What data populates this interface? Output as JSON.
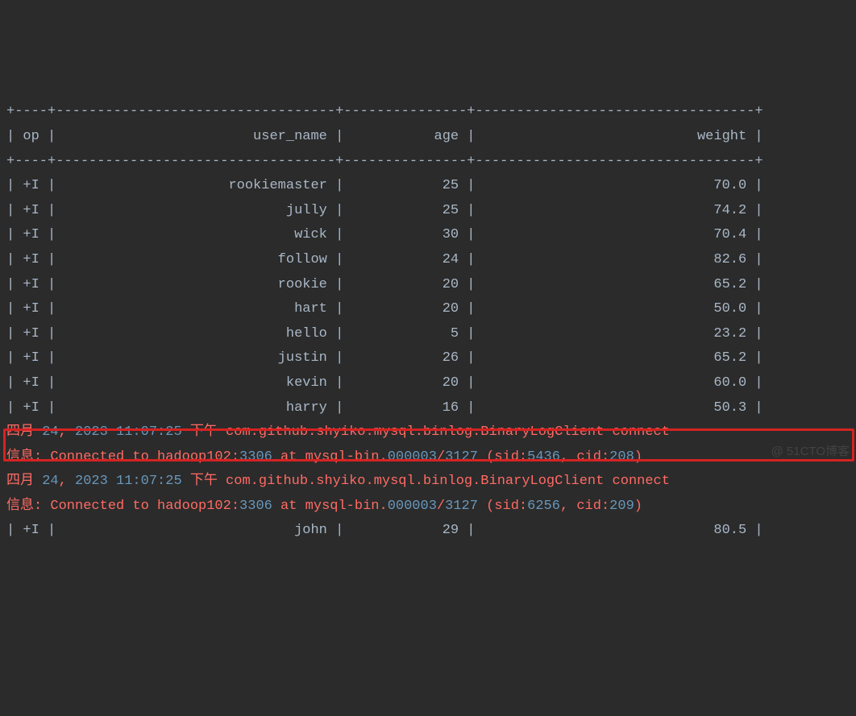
{
  "chart_data": {
    "type": "table",
    "columns": [
      "op",
      "user_name",
      "age",
      "weight"
    ],
    "rows": [
      {
        "op": "+I",
        "user_name": "rookiemaster",
        "age": 25,
        "weight": 70.0
      },
      {
        "op": "+I",
        "user_name": "jully",
        "age": 25,
        "weight": 74.2
      },
      {
        "op": "+I",
        "user_name": "wick",
        "age": 30,
        "weight": 70.4
      },
      {
        "op": "+I",
        "user_name": "follow",
        "age": 24,
        "weight": 82.6
      },
      {
        "op": "+I",
        "user_name": "rookie",
        "age": 20,
        "weight": 65.2
      },
      {
        "op": "+I",
        "user_name": "hart",
        "age": 20,
        "weight": 50.0
      },
      {
        "op": "+I",
        "user_name": "hello",
        "age": 5,
        "weight": 23.2
      },
      {
        "op": "+I",
        "user_name": "justin",
        "age": 26,
        "weight": 65.2
      },
      {
        "op": "+I",
        "user_name": "kevin",
        "age": 20,
        "weight": 60.0
      },
      {
        "op": "+I",
        "user_name": "harry",
        "age": 16,
        "weight": 50.3
      },
      {
        "op": "+I",
        "user_name": "john",
        "age": 29,
        "weight": 80.5
      }
    ],
    "log_row_after_index": 10,
    "highlighted_row_index": 10
  },
  "col_widths": {
    "op": 2,
    "user_name": 32,
    "age": 13,
    "weight": 32
  },
  "border": {
    "top": "+----+----------------------------------+---------------+----------------------------------+",
    "mid": "+----+----------------------------------+---------------+----------------------------------+"
  },
  "logs": [
    {
      "line1_prefix": "四月 ",
      "line1_date": "24",
      "line1_comma": ", ",
      "line1_year": "2023",
      "line1_space": " ",
      "line1_time": "11:07:25",
      "line1_rest": " 下午 com.github.shyiko.mysql.binlog.BinaryLogClient connect",
      "line2_prefix": "信息: Connected to hadoop102:",
      "line2_port": "3306",
      "line2_mid1": " at mysql-bin.",
      "line2_file": "000003",
      "line2_slash": "/",
      "line2_pos": "3127",
      "line2_sid_label": " (sid:",
      "line2_sid": "5436",
      "line2_cid_label": ", cid:",
      "line2_cid": "208",
      "line2_end": ")"
    },
    {
      "line1_prefix": "四月 ",
      "line1_date": "24",
      "line1_comma": ", ",
      "line1_year": "2023",
      "line1_space": " ",
      "line1_time": "11:07:25",
      "line1_rest": " 下午 com.github.shyiko.mysql.binlog.BinaryLogClient connect",
      "line2_prefix": "信息: Connected to hadoop102:",
      "line2_port": "3306",
      "line2_mid1": " at mysql-bin.",
      "line2_file": "000003",
      "line2_slash": "/",
      "line2_pos": "3127",
      "line2_sid_label": " (sid:",
      "line2_sid": "6256",
      "line2_cid_label": ", cid:",
      "line2_cid": "209",
      "line2_end": ")"
    }
  ],
  "watermark": "@ 51CTO博客"
}
